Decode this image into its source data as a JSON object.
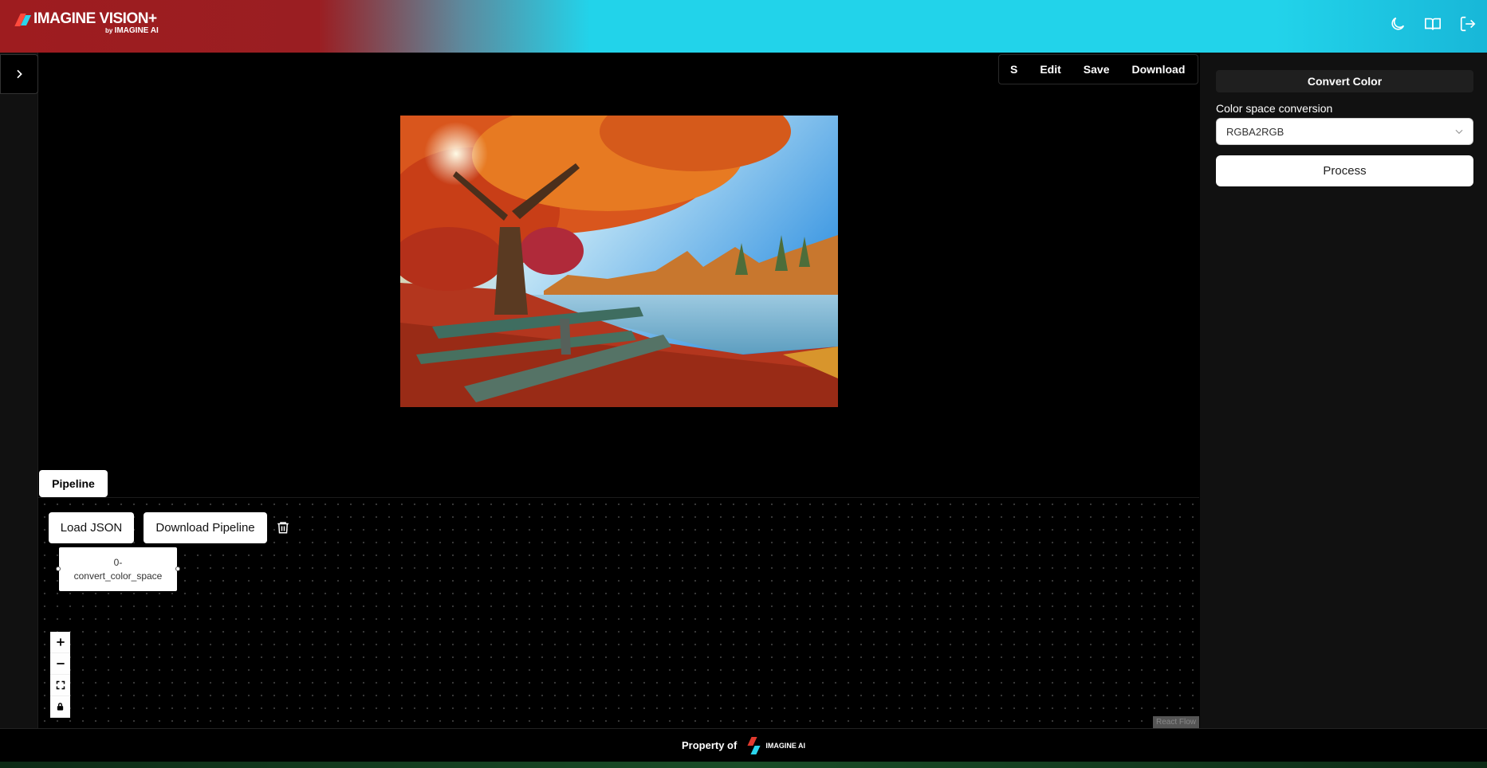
{
  "app": {
    "logo_title": "IMAGINE VISION+",
    "logo_by": "by",
    "logo_company": "IMAGINE AI"
  },
  "header": {
    "icons": [
      "moon-icon",
      "book-icon",
      "logout-icon"
    ]
  },
  "toolbar": {
    "s_label": "S",
    "edit_label": "Edit",
    "save_label": "Save",
    "download_label": "Download"
  },
  "panel": {
    "title": "Convert Color",
    "field_label": "Color space conversion",
    "select_value": "RGBA2RGB",
    "process_label": "Process"
  },
  "pipeline": {
    "tab_label": "Pipeline",
    "load_json_label": "Load JSON",
    "download_pipeline_label": "Download Pipeline",
    "node_line1": "0-",
    "node_line2": "convert_color_space",
    "attribution": "React Flow"
  },
  "footer": {
    "property_label": "Property of",
    "company": "IMAGINE AI"
  },
  "colors": {
    "header_red": "#9e1c1f",
    "header_cyan": "#22d3ea",
    "panel_bg": "#111111"
  }
}
